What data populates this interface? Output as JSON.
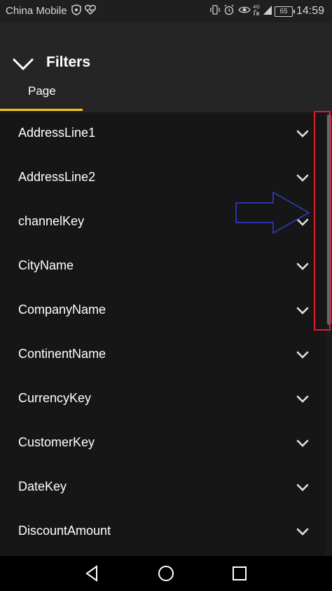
{
  "status_bar": {
    "carrier": "China Mobile",
    "battery": "65",
    "time": "14:59",
    "icons": [
      "shield-icon",
      "heart-rate-icon",
      "vibrate-icon",
      "eye-icon",
      "4g-signal-icon",
      "signal-icon"
    ]
  },
  "header": {
    "title": "Filters",
    "collapse_icon": "chevron-down-icon"
  },
  "tabs": [
    {
      "label": "Page",
      "active": true
    }
  ],
  "accent_color": "#f2c811",
  "filters": [
    {
      "label": "AddressLine1"
    },
    {
      "label": "AddressLine2"
    },
    {
      "label": "channelKey"
    },
    {
      "label": "CityName"
    },
    {
      "label": "CompanyName"
    },
    {
      "label": "ContinentName"
    },
    {
      "label": "CurrencyKey"
    },
    {
      "label": "CustomerKey"
    },
    {
      "label": "DateKey"
    },
    {
      "label": "DiscountAmount"
    }
  ],
  "annotations": {
    "highlight_color": "#e21b2a",
    "arrow_color": "#2f3fd6"
  },
  "nav_bar": {
    "buttons": [
      "back-icon",
      "home-icon",
      "recents-icon"
    ]
  }
}
